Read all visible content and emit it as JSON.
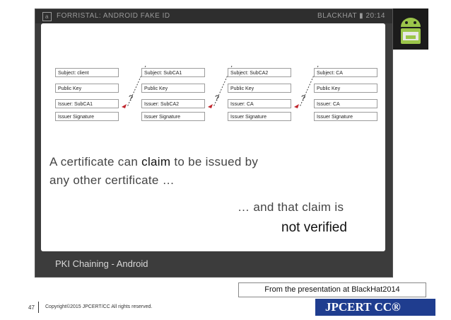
{
  "window": {
    "title": "FORRISTAL: ANDROID FAKE ID",
    "logo_letter": "a",
    "status": "BLACKHAT ▮ 20:14",
    "footer_label": "PKI Chaining - Android"
  },
  "certs": [
    {
      "subject": "Subject: client",
      "key": "Public Key",
      "issuer": "Issuer: SubCA1",
      "sig": "Issuer Signature"
    },
    {
      "subject": "Subject: SubCA1",
      "key": "Public Key",
      "issuer": "Issuer: SubCA2",
      "sig": "Issuer Signature"
    },
    {
      "subject": "Subject: SubCA2",
      "key": "Public Key",
      "issuer": "Issuer: CA",
      "sig": "Issuer Signature"
    },
    {
      "subject": "Subject: CA",
      "key": "Public Key",
      "issuer": "Issuer: CA",
      "sig": "Issuer Signature"
    }
  ],
  "qmark": "?",
  "text": {
    "line1_a": "A certificate can ",
    "line1_claim": "claim",
    "line1_b": " to be issued by",
    "line2": "any other certificate …",
    "line3": "… and that claim is",
    "line4": "not verified"
  },
  "caption": "From the presentation at BlackHat2014",
  "footer": {
    "page": "47",
    "copyright": "Copyright©2015 JPCERT/CC All rights reserved.",
    "brand": "JPCERT CC®"
  },
  "colors": {
    "brand": "#1f3d8f",
    "frame": "#3c3c3c",
    "accent_red": "#c0262d"
  }
}
